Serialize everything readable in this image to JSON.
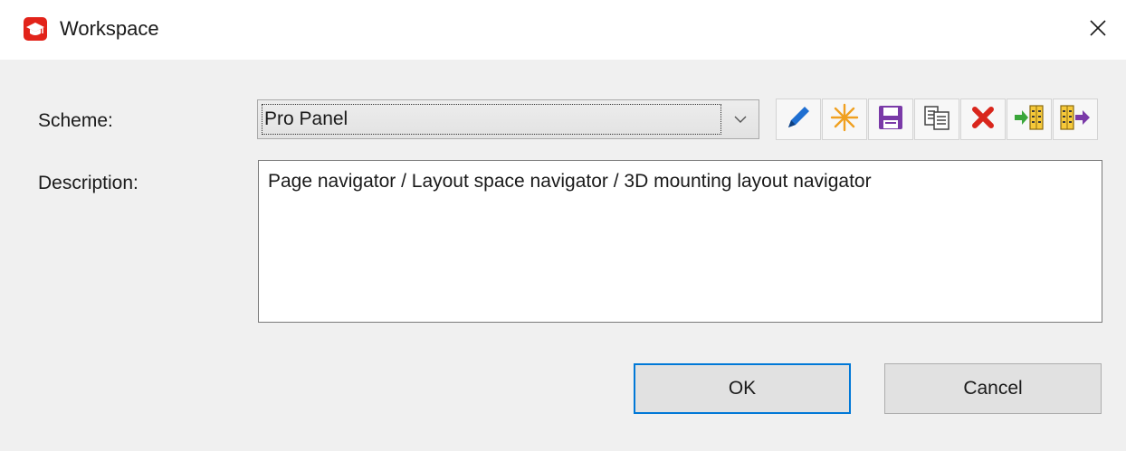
{
  "window": {
    "title": "Workspace",
    "app_icon": "graduation-cap-icon",
    "close_icon": "close-icon"
  },
  "form": {
    "scheme_label": "Scheme:",
    "scheme_value": "Pro Panel",
    "description_label": "Description:",
    "description_value": "Page navigator / Layout space navigator / 3D mounting layout navigator"
  },
  "toolbar": {
    "buttons": [
      {
        "icon": "pencil-icon",
        "action": "edit"
      },
      {
        "icon": "asterisk-icon",
        "action": "new"
      },
      {
        "icon": "save-icon",
        "action": "save"
      },
      {
        "icon": "copy-icon",
        "action": "copy"
      },
      {
        "icon": "delete-icon",
        "action": "delete"
      },
      {
        "icon": "import-icon",
        "action": "import"
      },
      {
        "icon": "export-icon",
        "action": "export"
      }
    ]
  },
  "buttons": {
    "ok_label": "OK",
    "cancel_label": "Cancel"
  },
  "colors": {
    "accent": "#0078d7",
    "app_icon_red": "#e2231a",
    "edit_blue": "#1f6fd1",
    "new_orange": "#f0a020",
    "save_purple": "#7a3aa8",
    "delete_red": "#d9261c",
    "import_green": "#3aa63a"
  }
}
